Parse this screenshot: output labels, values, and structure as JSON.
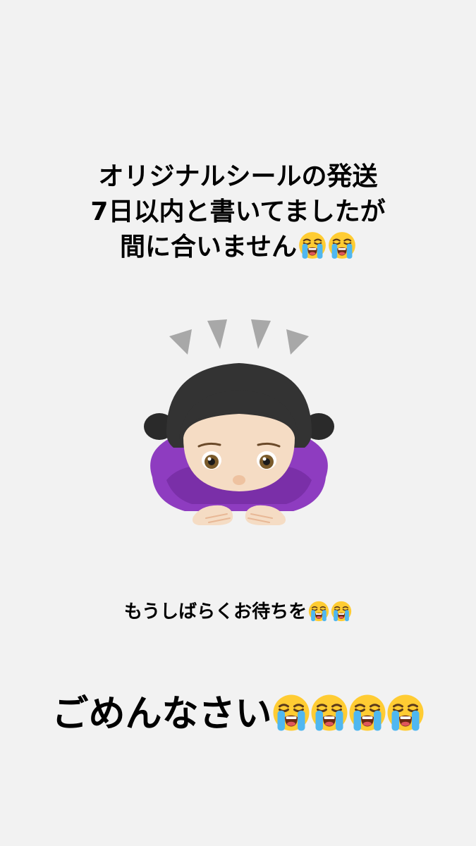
{
  "headline": {
    "line1": "オリジナルシールの発送",
    "line2": "7日以内と書いてましたが",
    "line3": "間に合いません"
  },
  "subtext": "もうしばらくお待ちを",
  "apology": "ごめんなさい",
  "icons": {
    "headline_emoji": "loudly-crying-face-icon",
    "subtext_emoji": "loudly-crying-face-icon",
    "apology_emoji": "loudly-crying-face-icon",
    "illustration": "woman-bowing-icon"
  },
  "colors": {
    "background": "#f2f2f2",
    "text": "#000000",
    "emoji_face": "#ffca28",
    "emoji_tears": "#4fc3f7",
    "sweater": "#8e3cc0"
  }
}
